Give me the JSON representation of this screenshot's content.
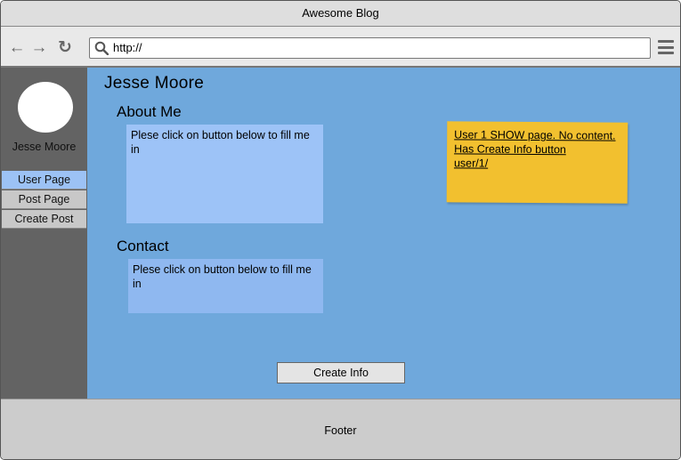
{
  "window": {
    "title": "Awesome Blog"
  },
  "browser": {
    "url": "http://",
    "back_icon": "arrow-left-icon",
    "forward_icon": "arrow-right-icon",
    "reload_icon": "reload-icon",
    "menu_icon": "hamburger-menu-icon"
  },
  "sidebar": {
    "name": "Jesse Moore",
    "items": [
      {
        "label": "User Page",
        "active": true
      },
      {
        "label": "Post Page",
        "active": false
      },
      {
        "label": "Create Post",
        "active": false
      }
    ]
  },
  "main": {
    "title": "Jesse Moore",
    "about": {
      "heading": "About Me",
      "text": "Plese click on button below to fill me in"
    },
    "contact": {
      "heading": "Contact",
      "text": "Plese click on button below to fill me in"
    },
    "create_button": "Create Info"
  },
  "note": {
    "line1": "User 1 SHOW page. No content. Has Create Info button",
    "line2": "user/1/"
  },
  "footer": {
    "text": "Footer"
  },
  "colors": {
    "main_bg": "#6fa8dc",
    "sidebar_bg": "#636363",
    "active_item": "#9cc2f5",
    "note_bg": "#f2c02f"
  }
}
